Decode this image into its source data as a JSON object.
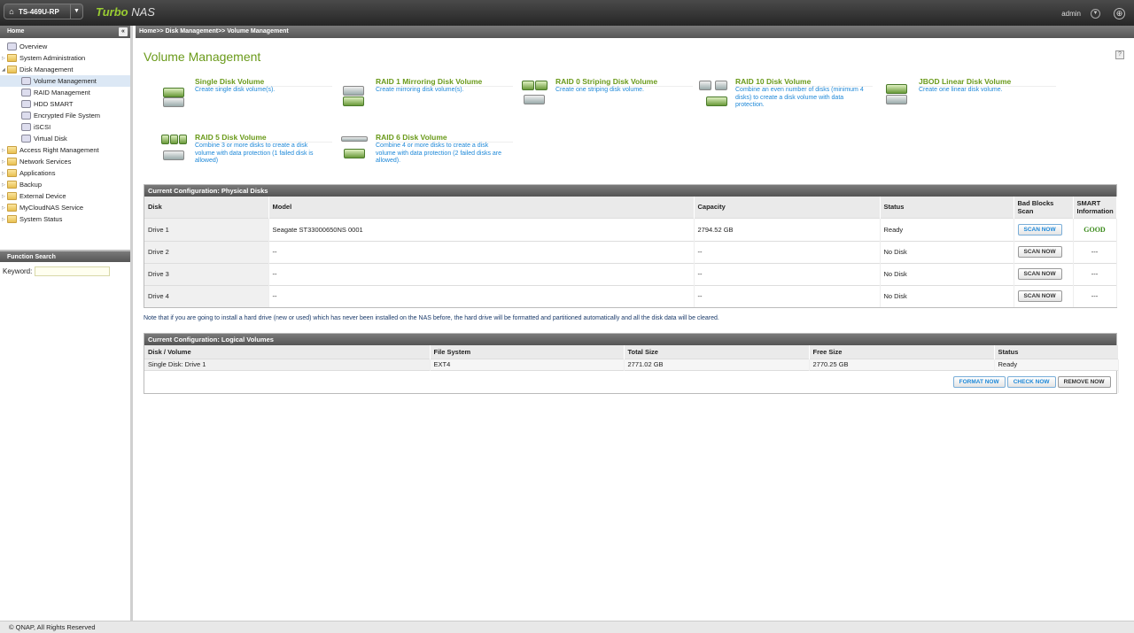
{
  "header": {
    "model": "TS-469U-RP",
    "brand_bold": "Turbo",
    "brand_light": "NAS",
    "user": "admin"
  },
  "sidebar": {
    "title": "Home",
    "items": [
      {
        "label": "Overview",
        "level": 0,
        "type": "leaf"
      },
      {
        "label": "System Administration",
        "level": 0,
        "type": "folder"
      },
      {
        "label": "Disk Management",
        "level": 0,
        "type": "folder",
        "expanded": true
      },
      {
        "label": "Volume Management",
        "level": 1,
        "type": "leaf",
        "selected": true
      },
      {
        "label": "RAID Management",
        "level": 1,
        "type": "leaf"
      },
      {
        "label": "HDD SMART",
        "level": 1,
        "type": "leaf"
      },
      {
        "label": "Encrypted File System",
        "level": 1,
        "type": "leaf"
      },
      {
        "label": "iSCSI",
        "level": 1,
        "type": "leaf"
      },
      {
        "label": "Virtual Disk",
        "level": 1,
        "type": "leaf"
      },
      {
        "label": "Access Right Management",
        "level": 0,
        "type": "folder"
      },
      {
        "label": "Network Services",
        "level": 0,
        "type": "folder"
      },
      {
        "label": "Applications",
        "level": 0,
        "type": "folder"
      },
      {
        "label": "Backup",
        "level": 0,
        "type": "folder"
      },
      {
        "label": "External Device",
        "level": 0,
        "type": "folder"
      },
      {
        "label": "MyCloudNAS Service",
        "level": 0,
        "type": "folder"
      },
      {
        "label": "System Status",
        "level": 0,
        "type": "folder"
      }
    ],
    "search_title": "Function Search",
    "keyword_label": "Keyword:",
    "keyword_value": ""
  },
  "breadcrumb": "Home>> Disk Management>> Volume Management",
  "main": {
    "title": "Volume Management",
    "volume_types": [
      {
        "name": "Single Disk Volume",
        "desc": "Create single disk volume(s)."
      },
      {
        "name": "RAID 1 Mirroring Disk Volume",
        "desc": "Create mirroring disk volume(s)."
      },
      {
        "name": "RAID 0 Striping Disk Volume",
        "desc": "Create one striping disk volume."
      },
      {
        "name": "RAID 10 Disk Volume",
        "desc": "Combine an even number of disks (minimum 4 disks) to create a disk volume with data protection."
      },
      {
        "name": "JBOD Linear Disk Volume",
        "desc": "Create one linear disk volume."
      },
      {
        "name": "RAID 5 Disk Volume",
        "desc": "Combine 3 or more disks to create a disk volume with data protection (1 failed disk is allowed)"
      },
      {
        "name": "RAID 6 Disk Volume",
        "desc": "Combine 4 or more disks to create a disk volume with data protection (2 failed disks are allowed)."
      }
    ],
    "physical": {
      "title": "Current Configuration: Physical Disks",
      "headers": [
        "Disk",
        "Model",
        "Capacity",
        "Status",
        "Bad Blocks Scan",
        "SMART Information"
      ],
      "rows": [
        {
          "disk": "Drive 1",
          "model": "Seagate ST33000650NS 0001",
          "capacity": "2794.52 GB",
          "status": "Ready",
          "scan": "SCAN NOW",
          "smart": "GOOD"
        },
        {
          "disk": "Drive 2",
          "model": "--",
          "capacity": "--",
          "status": "No Disk",
          "scan": "SCAN NOW",
          "smart": "---"
        },
        {
          "disk": "Drive 3",
          "model": "--",
          "capacity": "--",
          "status": "No Disk",
          "scan": "SCAN NOW",
          "smart": "---"
        },
        {
          "disk": "Drive 4",
          "model": "--",
          "capacity": "--",
          "status": "No Disk",
          "scan": "SCAN NOW",
          "smart": "---"
        }
      ]
    },
    "note": "Note that if you are going to install a hard drive (new or used) which has never been installed on the NAS before, the hard drive will be formatted and partitioned automatically and all the disk data will be cleared.",
    "logical": {
      "title": "Current Configuration: Logical Volumes",
      "headers": [
        "Disk / Volume",
        "File System",
        "Total Size",
        "Free Size",
        "Status"
      ],
      "rows": [
        {
          "volume": "Single Disk: Drive 1",
          "fs": "EXT4",
          "total": "2771.02 GB",
          "free": "2770.25 GB",
          "status": "Ready"
        }
      ],
      "buttons": {
        "format": "FORMAT NOW",
        "check": "CHECK NOW",
        "remove": "REMOVE NOW"
      }
    }
  },
  "footer": "© QNAP, All Rights Reserved",
  "icons": [
    "home-icon",
    "dropdown-arrow-icon",
    "user-menu-icon",
    "globe-icon",
    "collapse-icon",
    "help-icon",
    "folder-icon",
    "disk-icon"
  ]
}
